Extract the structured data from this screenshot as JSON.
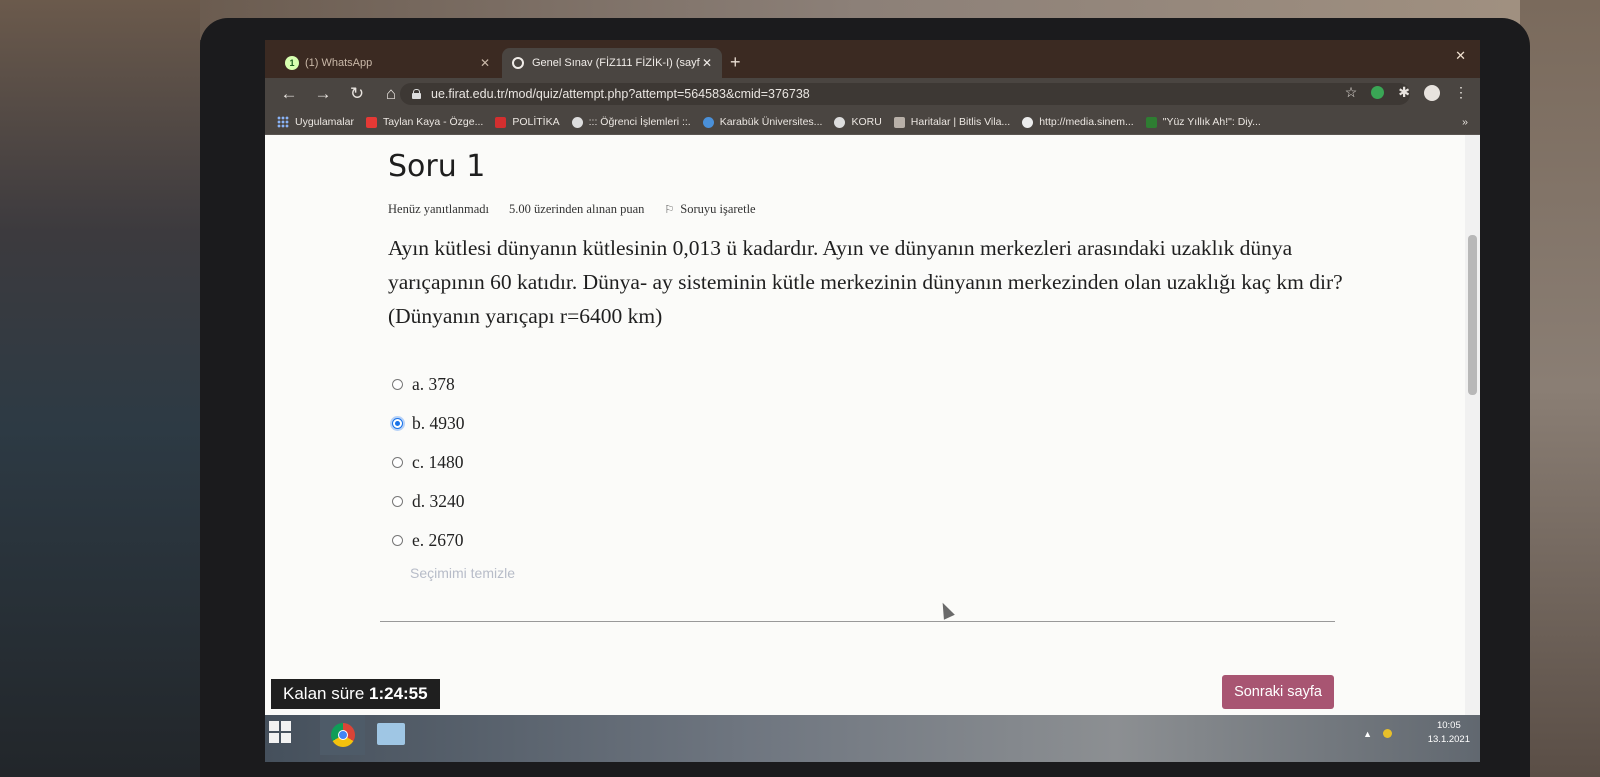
{
  "browser": {
    "tabs": [
      {
        "title": "(1) WhatsApp",
        "badge": "1",
        "active": false
      },
      {
        "title": "Genel Sınav (FİZ111 FİZİK-I) (sayf",
        "active": true
      }
    ],
    "url": "ue.firat.edu.tr/mod/quiz/attempt.php?attempt=564583&cmid=376738",
    "bookmarks": [
      "Uygulamalar",
      "Taylan Kaya - Özge...",
      "POLİTİKA",
      "::: Öğrenci İşlemleri ::.",
      "Karabük Üniversites...",
      "KORU",
      "Haritalar | Bitlis Vila...",
      "http://media.sinem...",
      "\"Yüz Yıllık Ah!\": Diy..."
    ],
    "bookmarks_more": "»"
  },
  "question": {
    "title": "Soru 1",
    "status": "Henüz yanıtlanmadı",
    "points": "5.00 üzerinden alınan puan",
    "flag_label": "Soruyu işaretle",
    "text": "Ayın kütlesi dünyanın kütlesinin 0,013 ü kadardır. Ayın ve dünyanın merkezleri arasındaki uzaklık dünya yarıçapının 60 katıdır. Dünya- ay sisteminin kütle merkezinin dünyanın merkezinden olan uzaklığı kaç km dir? (Dünyanın yarıçapı r=6400 km)",
    "options": [
      {
        "label": "a. 378",
        "selected": false
      },
      {
        "label": "b. 4930",
        "selected": true
      },
      {
        "label": "c. 1480",
        "selected": false
      },
      {
        "label": "d. 3240",
        "selected": false
      },
      {
        "label": "e. 2670",
        "selected": false
      }
    ],
    "clear_label": "Seçimimi temizle"
  },
  "footer": {
    "timer_label": "Kalan süre",
    "timer_value": "1:24:55",
    "next_label": "Sonraki sayfa"
  },
  "taskbar": {
    "time": "10:05",
    "date": "13.1.2021"
  },
  "colors": {
    "next_button": "#a85572",
    "selected_radio": "#1a73e8",
    "clear_link": "#b7bcc8"
  }
}
